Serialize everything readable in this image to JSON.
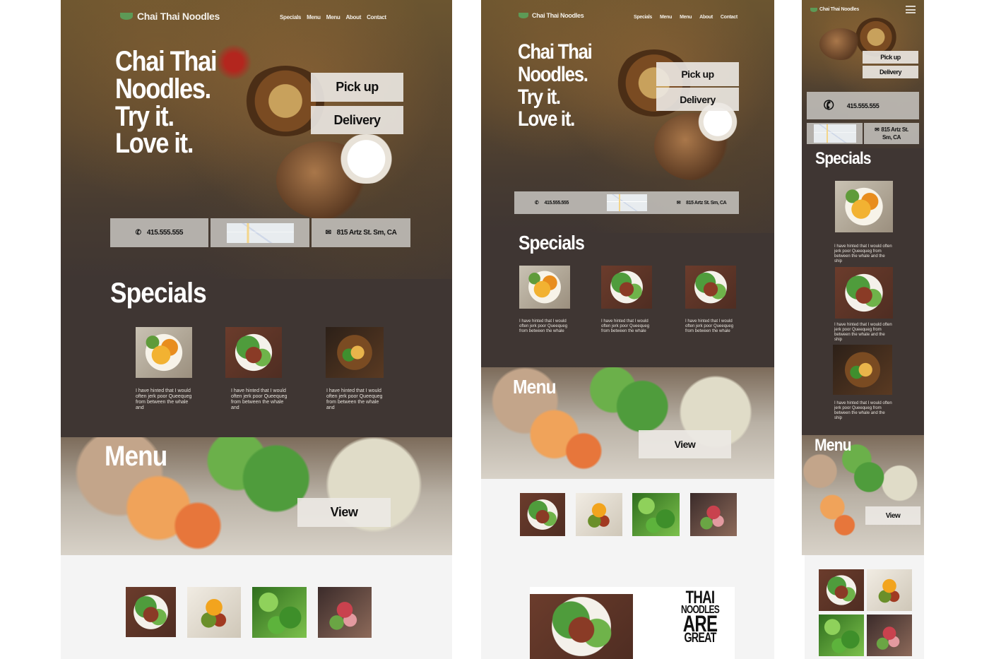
{
  "brand": {
    "name": "Chai Thai Noodles",
    "accent": "#5d9a56"
  },
  "nav": [
    "Specials",
    "Menu",
    "Menu",
    "About",
    "Contact"
  ],
  "hero": {
    "line1": "Chai Thai",
    "line2": "Noodles.",
    "line3": "Try it.",
    "line4": "Love it."
  },
  "order": {
    "pickup": "Pick up",
    "delivery": "Delivery"
  },
  "contact": {
    "phone": "415.555.555",
    "address": "815 Artz St. Sm, CA",
    "address_line1": "815 Artz St.",
    "address_line2": "Sm, CA"
  },
  "icons": {
    "phone": "phone-icon",
    "mail": "mail-icon",
    "map": "map-icon",
    "bowl": "bowl-logo-icon",
    "hamburger": "hamburger-menu-icon"
  },
  "specials": {
    "title": "Specials",
    "caption_desktop": "I have hinted that I would often jerk poor Queequeg from between the whale and",
    "caption_tablet": "I have hinted that I would often jerk poor Queequeg from between the whale",
    "caption_mobile": "I have hinted that I would often jerk poor Queequeg from between the whale and the ship"
  },
  "menu": {
    "title": "Menu",
    "view": "View"
  },
  "promo": {
    "line1": "THAI",
    "line2": "NOODLES",
    "line3": "ARE",
    "line4": "GREAT"
  },
  "colors": {
    "dark_section": "#3f3633",
    "button_bg": "#ece9e4",
    "page_bg": "#f4f4f4"
  }
}
